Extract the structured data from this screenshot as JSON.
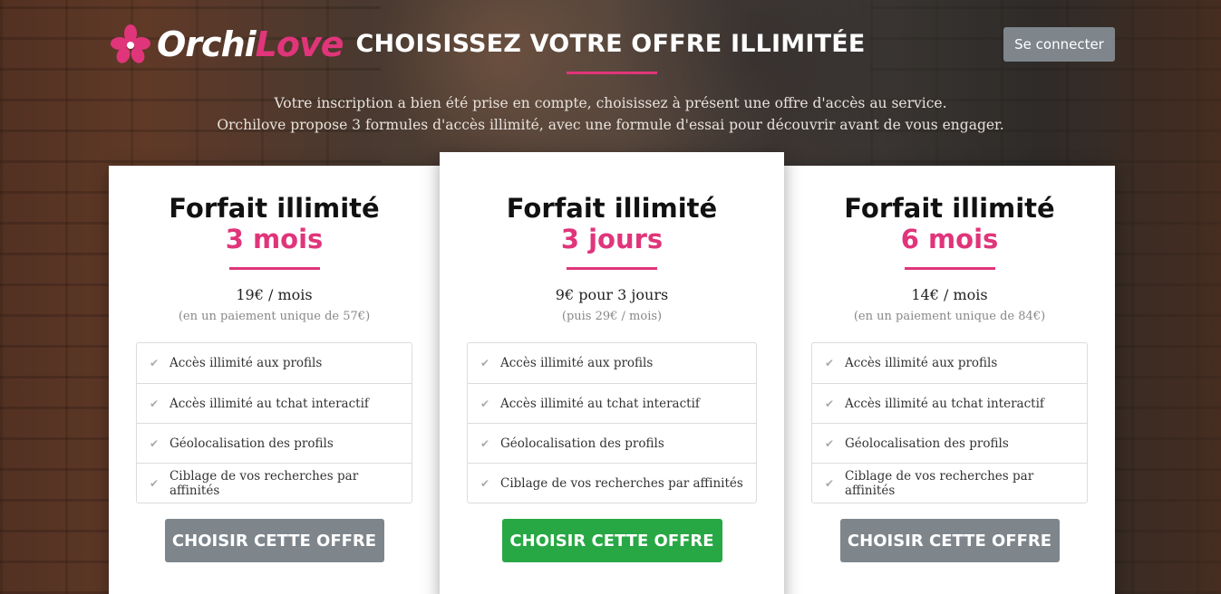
{
  "brand": {
    "part1": "Orchi",
    "part2": "Love",
    "accent_color": "#e0357a",
    "icon": "orchid-flower-icon"
  },
  "header": {
    "title": "CHOISISSEZ VOTRE OFFRE ILLIMITÉE",
    "login_label": "Se connecter"
  },
  "intro": {
    "line1": "Votre inscription a bien été prise en compte, choisissez à présent une offre d'accès au service.",
    "line2": "Orchilove propose 3 formules d'accès illimité, avec une formule d'essai pour découvrir avant de vous engager."
  },
  "plans": [
    {
      "title": "Forfait illimité",
      "duration": "3 mois",
      "price": "19€ / mois",
      "note": "(en un paiement unique de 57€)",
      "features": [
        "Accès illimité aux profils",
        "Accès illimité au tchat interactif",
        "Géolocalisation des profils",
        "Ciblage de vos recherches par affinités"
      ],
      "cta": "CHOISIR CETTE OFFRE",
      "cta_color": "#7e868c"
    },
    {
      "title": "Forfait illimité",
      "duration": "3 jours",
      "price": "9€ pour 3 jours",
      "note": "(puis 29€ / mois)",
      "features": [
        "Accès illimité aux profils",
        "Accès illimité au tchat interactif",
        "Géolocalisation des profils",
        "Ciblage de vos recherches par affinités"
      ],
      "cta": "CHOISIR CETTE OFFRE",
      "cta_color": "#28a745"
    },
    {
      "title": "Forfait illimité",
      "duration": "6 mois",
      "price": "14€ / mois",
      "note": "(en un paiement unique de 84€)",
      "features": [
        "Accès illimité aux profils",
        "Accès illimité au tchat interactif",
        "Géolocalisation des profils",
        "Ciblage de vos recherches par affinités"
      ],
      "cta": "CHOISIR CETTE OFFRE",
      "cta_color": "#7e868c"
    }
  ]
}
